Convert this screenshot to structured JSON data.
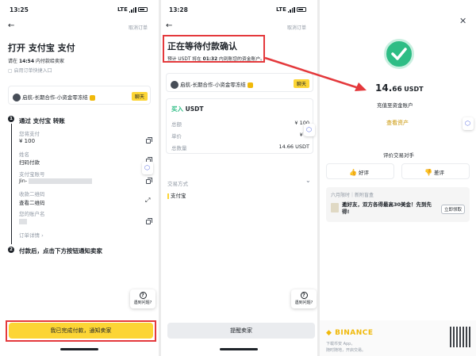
{
  "panel1": {
    "status": {
      "time": "13:25",
      "network": "LTE"
    },
    "header": {
      "cancel": "取消订单"
    },
    "title": "打开 支付宝 支付",
    "deadline_prefix": "请在",
    "deadline_time": "14:54",
    "deadline_suffix": "内付款给卖家",
    "sub_link": "启用订单快捷入口",
    "merchant": {
      "name": "启航-长期合作-小资金零冻结",
      "chat": "聊天"
    },
    "step1_title": "通过 支付宝 转账",
    "fields": [
      {
        "label": "您将支付",
        "value": "¥ 100"
      },
      {
        "label": "姓名",
        "value": "扫码付款"
      },
      {
        "label": "支付宝账号",
        "value": "Jin-"
      },
      {
        "label": "收款二维码",
        "value": "查看二维码"
      },
      {
        "label": "您的账户名",
        "value": ""
      }
    ],
    "order_details": "订单详情",
    "step2_title": "付款后，点击下方按钮通知卖家",
    "help_label": "遇到问题?",
    "primary_button": "我已完成付款，通知卖家"
  },
  "panel2": {
    "status": {
      "time": "13:28",
      "network": "LTE"
    },
    "header": {
      "cancel": "取消订单"
    },
    "title": "正在等待付款确认",
    "sub_prefix": "预计 USDT 将在",
    "sub_time": "01:32",
    "sub_suffix": "内到账您的资金账户。",
    "merchant": {
      "name": "启航-长期合作-小资金零冻结",
      "chat": "聊天"
    },
    "buy_label": "买入",
    "buy_asset": "USDT",
    "rows": [
      {
        "label": "总额",
        "value": "¥ 100"
      },
      {
        "label": "单价",
        "value": "¥ 6."
      },
      {
        "label": "总数量",
        "value": "14.66 USDT"
      }
    ],
    "pay_method_label": "交易方式",
    "pay_method_value": "支付宝",
    "help_label": "遇到问题?",
    "remind_button": "提醒卖家"
  },
  "panel3": {
    "amount_int": "14.",
    "amount_dec": "66",
    "amount_unit": "USDT",
    "credited": "充值至资金账户",
    "view_assets": "查看资产",
    "rate_title": "评价交易对手",
    "good": "好评",
    "bad": "差评",
    "promo_header": "六月限时｜新附盲盒",
    "promo_text": "邀好友，双方各得最高30美金！先到先得!",
    "promo_button": "立即领取",
    "brand": "BINANCE",
    "download_line1": "下载币安 App，",
    "download_line2": "随时随地，开启交易。"
  },
  "colors": {
    "accent": "#fcd535",
    "highlight": "#e4393c",
    "success": "#2ebd85"
  }
}
